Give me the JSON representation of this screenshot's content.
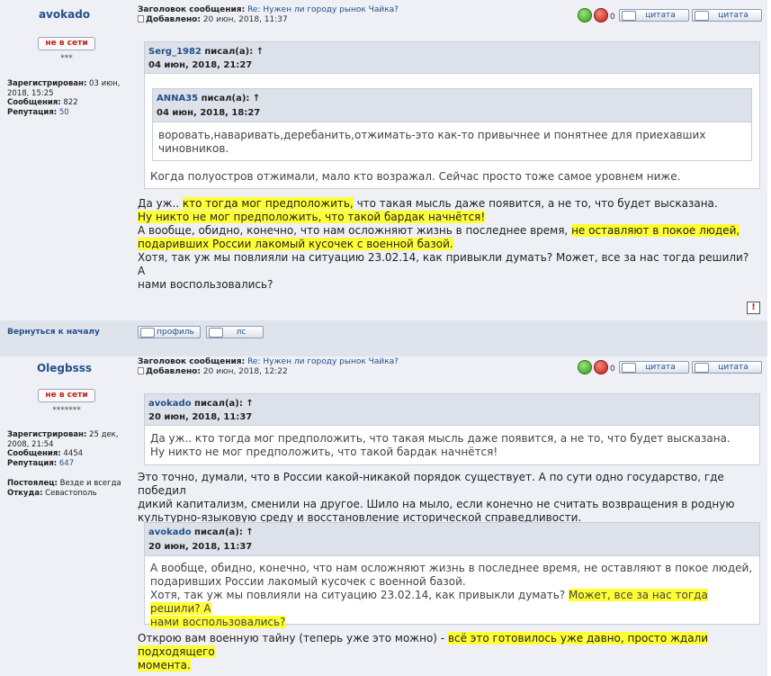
{
  "labels": {
    "subject_label": "Заголовок сообщения:",
    "added_label": "Добавлено:",
    "registered_label": "Зарегистрирован:",
    "posts_label": "Сообщения:",
    "reputation_label": "Репутация:",
    "resident_label": "Постоялец:",
    "from_label": "Откуда:",
    "wrote_suffix": " писал(а):",
    "arrow": "↑",
    "zero": "0",
    "quote_btn": "цитата",
    "profile_btn": "профиль",
    "pm_btn": "лс",
    "back_to_top": "Вернуться к началу",
    "warn": "!"
  },
  "post1": {
    "author": "avokado",
    "status": "не в сети",
    "rank": "***",
    "registered": "03 июн, 2018, 15:25",
    "posts": "822",
    "reputation": "50",
    "subject_prefix": "Re: ",
    "subject": "Нужен ли городу рынок Чайка?",
    "added": "20 июн, 2018, 11:37",
    "quote_outer_author": "Serg_1982",
    "quote_outer_date": "04 июн, 2018, 21:27",
    "quote_inner_author": "ANNA35",
    "quote_inner_date": "04 июн, 2018, 18:27",
    "quote_inner_line1": "воровать,наваривать,деребанить,отжимать-это как-то привычнее и понятнее для приехавших",
    "quote_inner_line2": "чиновников.",
    "quote_outer_text": "Когда полуостров отжимали, мало кто возражал. Сейчас просто тоже самое уровнем ниже.",
    "t1a": "Да уж.. ",
    "t1b": "кто тогда мог предположить,",
    "t1c": " что такая мысль даже появится, а не то, что будет высказана.",
    "t2": "Ну никто не мог предположить, что такой бардак начнётся!",
    "t3a": "А вообще, обидно, конечно, что нам осложняют жизнь в последнее время, ",
    "t3b": "не оставляют в покое людей,",
    "t4": "подаривших России лакомый кусочек с военной базой.",
    "t5": "Хотя, так уж мы повлияли на ситуацию 23.02.14, как привыкли думать? Может, все за нас тогда решили? А",
    "t6": "нами воспользовались?"
  },
  "post2": {
    "author": "Olegbsss",
    "status": "не в сети",
    "rank": "*******",
    "registered": "25 дек, 2008, 21:54",
    "posts": "4454",
    "reputation": "647",
    "resident": "Везде и всегда",
    "from": "Севастополь",
    "subject_prefix": "Re: ",
    "subject": "Нужен ли городу рынок Чайка?",
    "added": "20 июн, 2018, 12:22",
    "q1_author": "avokado",
    "q1_date": "20 июн, 2018, 11:37",
    "q1_line1": "Да уж.. кто тогда мог предположить, что такая мысль даже появится, а не то, что будет высказана.",
    "q1_line2": "Ну никто не мог предположить, что такой бардак начнётся!",
    "m1": "Это точно, думали, что в России какой-никакой порядок существует. А по сути одно государство, где победил",
    "m2": "дикий капитализм, сменили на другое. Шило на мыло, если конечно не считать возвращения в родную",
    "m3": "культурно-языковую среду и восстановление исторической справедливости.",
    "q2_author": "avokado",
    "q2_date": "20 июн, 2018, 11:37",
    "q2_line1": "А вообще, обидно, конечно, что нам осложняют жизнь в последнее время, не оставляют в покое людей,",
    "q2_line2": "подаривших России лакомый кусочек с военной базой.",
    "q2_line3a": "Хотя, так уж мы повлияли на ситуацию 23.02.14, как привыкли думать? ",
    "q2_line3b": "Может, все за нас тогда решили? А",
    "q2_line4": "нами воспользовались?",
    "e1a": "Открою вам военную тайну (теперь уже это можно) - ",
    "e1b": "всё это готовилось уже давно, просто ждали подходящего",
    "e2": "момента."
  }
}
